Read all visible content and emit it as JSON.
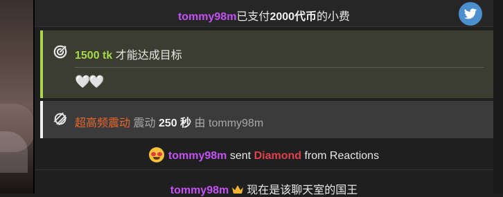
{
  "tip_row": {
    "username": "tommy98m",
    "text_before": "已支付",
    "amount": "2000代币",
    "text_after": "的小费"
  },
  "goal_row": {
    "amount": "1500 tk",
    "text": "才能达成目标",
    "hearts": "🤍🤍"
  },
  "vibe_row": {
    "level": "超高频震动",
    "text_vibe": "震动",
    "seconds": "250 秒",
    "by": "由",
    "username": "tommy98m"
  },
  "reaction_row": {
    "username": "tommy98m",
    "sent": "sent",
    "item": "Diamond",
    "from": "from Reactions"
  },
  "king_row": {
    "username": "tommy98m",
    "text": "现在是该聊天室的国王"
  },
  "colors": {
    "username": "#c353f4",
    "goal_accent": "#a6d94b",
    "vibe_level": "#e9662c",
    "diamond": "#e0414c",
    "twitter": "#4b8fcf"
  },
  "icons": [
    "twitter-icon",
    "goal-target-icon",
    "vibration-icon",
    "heart-eyes-emoji-icon",
    "crown-icon"
  ]
}
